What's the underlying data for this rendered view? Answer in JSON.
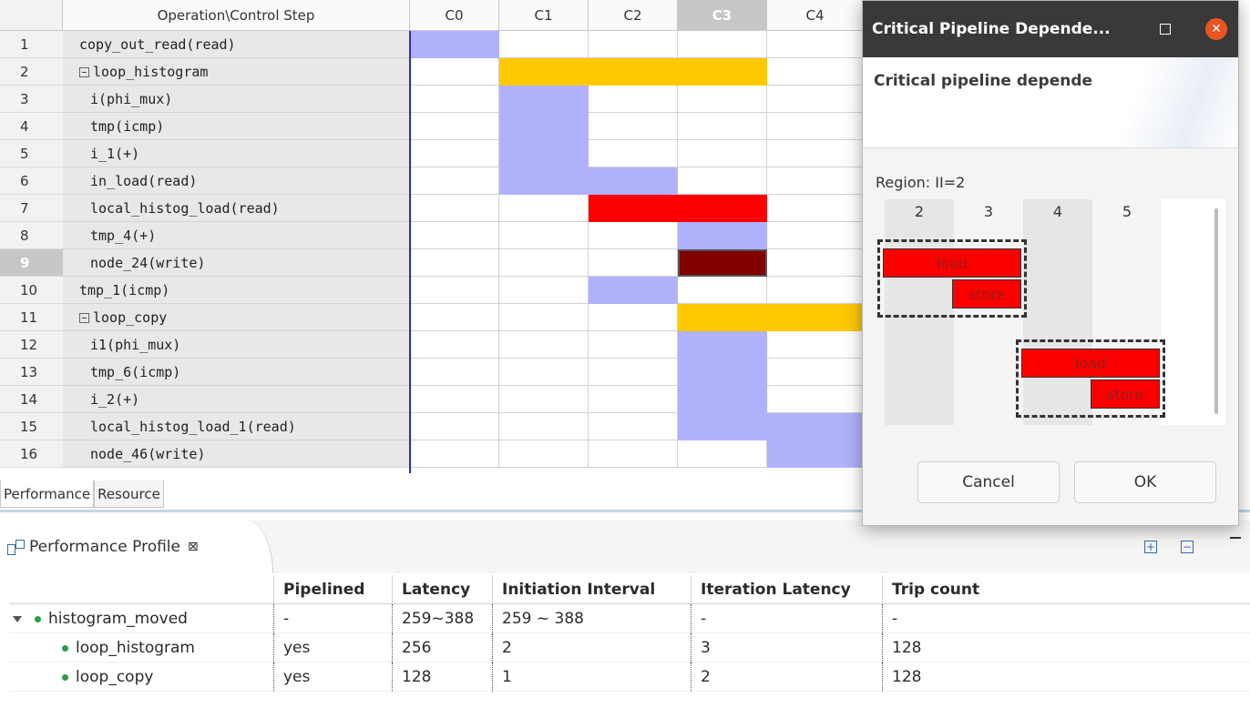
{
  "grid": {
    "index_header": "",
    "op_header": "Operation\\Control Step",
    "steps": [
      "C0",
      "C1",
      "C2",
      "C3",
      "C4"
    ],
    "selected_step": "C3",
    "rows": [
      {
        "n": "1",
        "name": "copy_out_read(read)"
      },
      {
        "n": "2",
        "name": "loop_histogram"
      },
      {
        "n": "3",
        "name": "i(phi_mux)"
      },
      {
        "n": "4",
        "name": "tmp(icmp)"
      },
      {
        "n": "5",
        "name": "i_1(+)"
      },
      {
        "n": "6",
        "name": "in_load(read)"
      },
      {
        "n": "7",
        "name": "local_histog_load(read)"
      },
      {
        "n": "8",
        "name": "tmp_4(+)"
      },
      {
        "n": "9",
        "name": "node_24(write)"
      },
      {
        "n": "10",
        "name": "tmp_1(icmp)"
      },
      {
        "n": "11",
        "name": "loop_copy"
      },
      {
        "n": "12",
        "name": "i1(phi_mux)"
      },
      {
        "n": "13",
        "name": "tmp_6(icmp)"
      },
      {
        "n": "14",
        "name": "i_2(+)"
      },
      {
        "n": "15",
        "name": "local_histog_load_1(read)"
      },
      {
        "n": "16",
        "name": "node_46(write)"
      }
    ],
    "selected_row": "9"
  },
  "view_tabs": [
    "Performance",
    "Resource"
  ],
  "profile": {
    "title": "Performance Profile",
    "close_glyph": "⊠",
    "columns": [
      "",
      "Pipelined",
      "Latency",
      "Initiation Interval",
      "Iteration Latency",
      "Trip count"
    ],
    "rows": [
      {
        "name": "histogram_moved",
        "pipelined": "-",
        "latency": "259~388",
        "ii": "259 ~ 388",
        "iter": "-",
        "trip": "-"
      },
      {
        "name": "loop_histogram",
        "pipelined": "yes",
        "latency": "256",
        "ii": "2",
        "iter": "3",
        "trip": "128"
      },
      {
        "name": "loop_copy",
        "pipelined": "yes",
        "latency": "128",
        "ii": "1",
        "iter": "2",
        "trip": "128"
      }
    ]
  },
  "dialog": {
    "title": "Critical Pipeline Depende...",
    "message": "Critical pipeline depende",
    "region": "Region: II=2",
    "columns": [
      "2",
      "3",
      "4",
      "5"
    ],
    "load_label": "load",
    "store_label": "store",
    "cancel_label": "Cancel",
    "ok_label": "OK"
  },
  "colors": {
    "op_bar": "#b1b1fb",
    "loop_bar": "#fec900",
    "critical_bar": "#fb0000",
    "selected_bar": "#800000",
    "dialog_titlebar": "#393939",
    "close_button": "#e95420"
  }
}
